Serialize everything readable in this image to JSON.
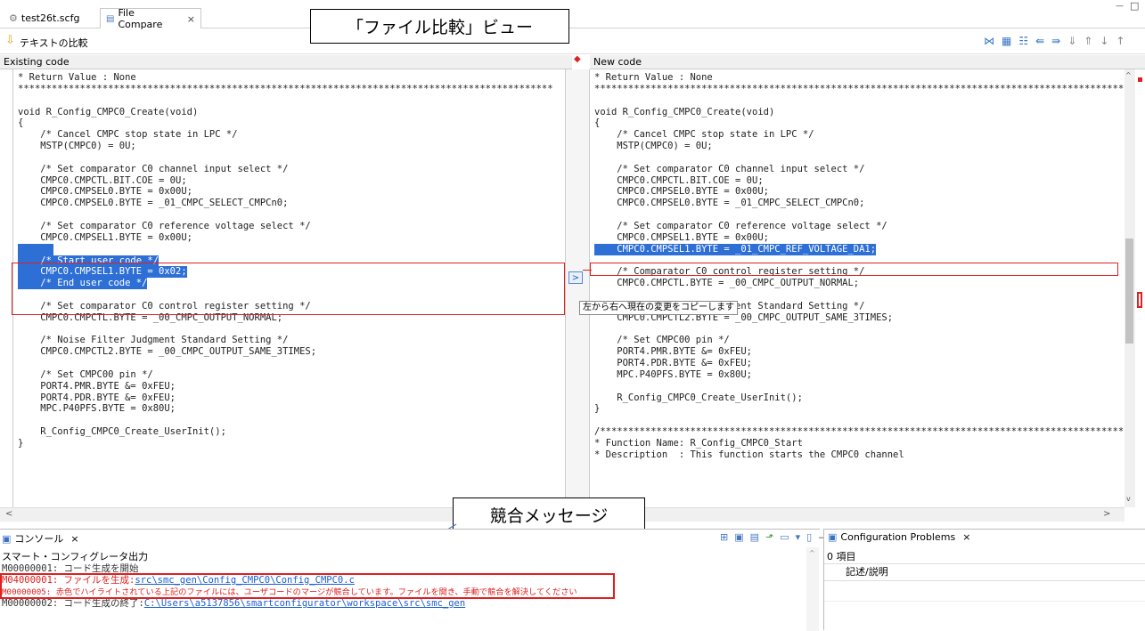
{
  "tabs": [
    {
      "label": "test26t.scfg",
      "icon": "gear-icon"
    },
    {
      "label": "File Compare",
      "icon": "compare-icon",
      "close": "×"
    }
  ],
  "window_controls": {
    "minimize": "—",
    "maximize": "□"
  },
  "toolbar": {
    "title": "テキストの比較"
  },
  "callouts": {
    "compare_view": "「ファイル比較」ビュー",
    "conflict_message": "競合メッセージ"
  },
  "left_pane": {
    "header": "Existing code",
    "lines": [
      "* Return Value : None",
      "***********************************************************************************************",
      "",
      "void R_Config_CMPC0_Create(void)",
      "{",
      "    /* Cancel CMPC stop state in LPC */",
      "    MSTP(CMPC0) = 0U;",
      "",
      "    /* Set comparator C0 channel input select */",
      "    CMPC0.CMPCTL.BIT.COE = 0U;",
      "    CMPC0.CMPSEL0.BYTE = 0x00U;",
      "    CMPC0.CMPSEL0.BYTE = _01_CMPC_SELECT_CMPCn0;",
      "",
      "    /* Set comparator C0 reference voltage select */",
      "    CMPC0.CMPSEL1.BYTE = 0x00U;",
      "",
      "    /* Start user code */",
      "    CMPC0.CMPSEL1.BYTE = 0x02;",
      "    /* End user code */",
      "",
      "    /* Set comparator C0 control register setting */",
      "    CMPC0.CMPCTL.BYTE = _00_CMPC_OUTPUT_NORMAL;",
      "",
      "    /* Noise Filter Judgment Standard Setting */",
      "    CMPC0.CMPCTL2.BYTE = _00_CMPC_OUTPUT_SAME_3TIMES;",
      "",
      "    /* Set CMPC00 pin */",
      "    PORT4.PMR.BYTE &= 0xFEU;",
      "    PORT4.PDR.BYTE &= 0xFEU;",
      "    MPC.P40PFS.BYTE = 0x80U;",
      "",
      "    R_Config_CMPC0_Create_UserInit();",
      "}"
    ]
  },
  "right_pane": {
    "header": "New code",
    "lines": [
      "* Return Value : None",
      "***********************************************************************************************",
      "",
      "void R_Config_CMPC0_Create(void)",
      "{",
      "    /* Cancel CMPC stop state in LPC */",
      "    MSTP(CMPC0) = 0U;",
      "",
      "    /* Set comparator C0 channel input select */",
      "    CMPC0.CMPCTL.BIT.COE = 0U;",
      "    CMPC0.CMPSEL0.BYTE = 0x00U;",
      "    CMPC0.CMPSEL0.BYTE = _01_CMPC_SELECT_CMPCn0;",
      "",
      "    /* Set comparator C0 reference voltage select */",
      "    CMPC0.CMPSEL1.BYTE = 0x00U;",
      "    CMPC0.CMPSEL1.BYTE = _01_CMPC_REF_VOLTAGE_DA1;",
      "",
      "    /* Comparator C0 control register setting */",
      "    CMPC0.CMPCTL.BYTE = _00_CMPC_OUTPUT_NORMAL;",
      "",
      "    /* Noise Filter Judgment Standard Setting */",
      "    CMPC0.CMPCTL2.BYTE = _00_CMPC_OUTPUT_SAME_3TIMES;",
      "",
      "    /* Set CMPC00 pin */",
      "    PORT4.PMR.BYTE &= 0xFEU;",
      "    PORT4.PDR.BYTE &= 0xFEU;",
      "    MPC.P40PFS.BYTE = 0x80U;",
      "",
      "    R_Config_CMPC0_Create_UserInit();",
      "}",
      "",
      "/***********************************************************************************************",
      "* Function Name: R_Config_CMPC0_Start",
      "* Description  : This function starts the CMPC0 channel"
    ]
  },
  "copy_button": {
    "label": ">",
    "tooltip": "左から右へ現在の変更をコピーします"
  },
  "console": {
    "tab_label": "コンソール",
    "subtitle": "スマート・コンフィグレータ出力",
    "line1": "M00000001: コード生成を開始",
    "line2_prefix": "M04000001: ファイルを生成:",
    "line2_link": "src\\smc_gen\\Config_CMPC0\\Config_CMPC0.c",
    "line3": "M00000005: 赤色でハイライトされている上記のファイルには、ユーザコードのマージが競合しています。ファイルを開き、手動で競合を解決してください",
    "line4_prefix": "M00000002: コード生成の終了:",
    "line4_link": "C:\\Users\\a5137856\\smartconfigurator\\workspace\\src\\smc_gen"
  },
  "problems": {
    "tab_label": "Configuration Problems",
    "count": "0 項目",
    "column": "記述/説明"
  },
  "colors": {
    "highlight": "#2e6fd6",
    "conflict": "#e02020",
    "link": "#1a5fd0"
  }
}
